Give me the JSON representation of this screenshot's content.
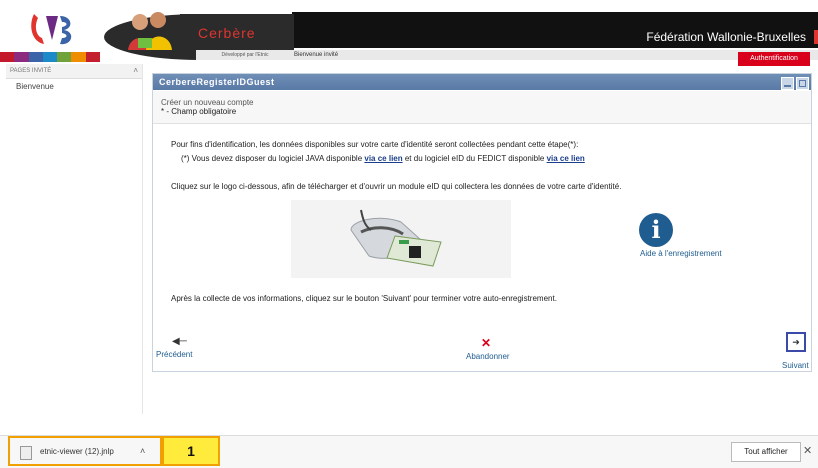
{
  "header": {
    "app_name": "Cerbère",
    "developer_line": "Développé par l'Etnic",
    "welcome": "Bienvenue invité",
    "federation": "Fédération Wallonie-Bruxelles",
    "auth_button": "Authentification",
    "color_bar": [
      "#c4182b",
      "#8b2a7e",
      "#3a63a8",
      "#1c8ac8",
      "#6fa33a",
      "#f08c00",
      "#c41f2e"
    ]
  },
  "sidebar": {
    "title": "PAGES INVITÉ",
    "collapse_icon": "chevron-up",
    "items": [
      {
        "label": "Bienvenue"
      }
    ]
  },
  "panel": {
    "title": "CerbereRegisterIDGuest",
    "subtitle": "Créer un nouveau compte",
    "required_note": "* - Champ obligatoire",
    "info1": "Pour fins d'identification, les données disponibles sur votre carte d'identité seront collectées pendant cette étape(*):",
    "info2_a": "(*) Vous devez disposer du logiciel JAVA disponible ",
    "info2_link1": "via ce lien",
    "info2_b": " et du logiciel eID du FEDICT disponible ",
    "info2_link2": "via ce lien",
    "info3": "Cliquez sur le logo ci-dessous, afin de télécharger et d'ouvrir un module eID qui collectera les données de votre carte d'identité.",
    "help_label": "Aide à l'enregistrement",
    "info4": "Après la collecte de vos informations, cliquez sur le bouton 'Suivant' pour terminer votre auto-enregistrement.",
    "prev_label": "Précédent",
    "cancel_label": "Abandonner",
    "next_label": "Suivant"
  },
  "download_bar": {
    "file_name": "etnic-viewer (12).jnlp",
    "badge": "1",
    "show_all": "Tout afficher",
    "close": "✕"
  }
}
